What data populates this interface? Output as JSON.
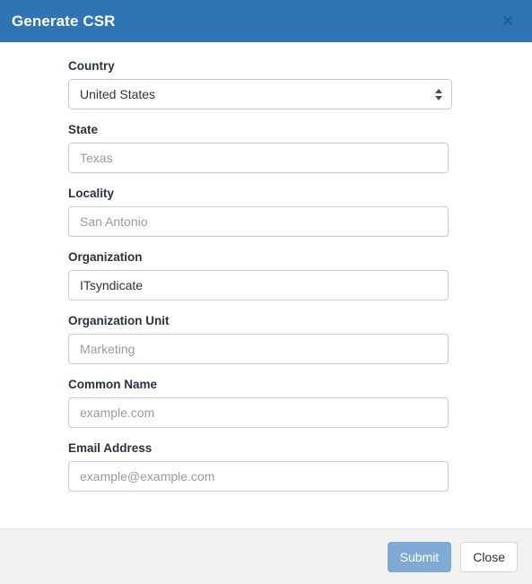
{
  "dialog": {
    "title": "Generate CSR",
    "close_icon_label": "×"
  },
  "form": {
    "fields": [
      {
        "label": "Country",
        "type": "select",
        "value": "United States",
        "placeholder": "",
        "name": "country"
      },
      {
        "label": "State",
        "type": "text",
        "value": "",
        "placeholder": "Texas",
        "name": "state"
      },
      {
        "label": "Locality",
        "type": "text",
        "value": "",
        "placeholder": "San Antonio",
        "name": "locality"
      },
      {
        "label": "Organization",
        "type": "text",
        "value": "ITsyndicate",
        "placeholder": "",
        "name": "organization"
      },
      {
        "label": "Organization Unit",
        "type": "text",
        "value": "",
        "placeholder": "Marketing",
        "name": "organization-unit"
      },
      {
        "label": "Common Name",
        "type": "text",
        "value": "",
        "placeholder": "example.com",
        "name": "common-name"
      },
      {
        "label": "Email Address",
        "type": "text",
        "value": "",
        "placeholder": "example@example.com",
        "name": "email-address"
      }
    ]
  },
  "footer": {
    "submit_label": "Submit",
    "close_label": "Close"
  },
  "colors": {
    "header_blue": "#2f74b3",
    "submit_blue": "#7eaad3",
    "footer_grey": "#f1f1f1",
    "label_text": "#2b333f",
    "placeholder_text": "#9b9b9b"
  }
}
